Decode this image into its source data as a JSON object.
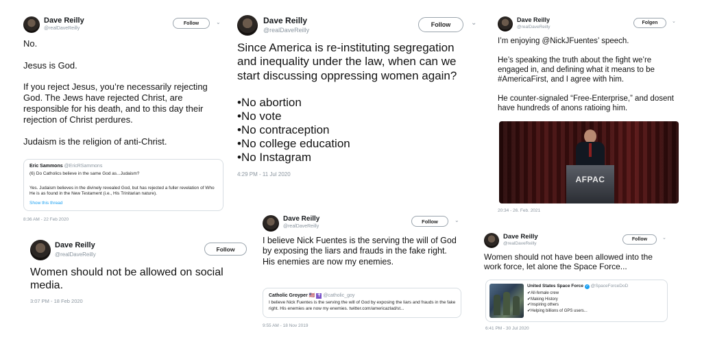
{
  "t1": {
    "name": "Dave Reilly",
    "handle": "@realDaveReilly",
    "follow": "Follow",
    "body": "No.\n\nJesus is God.\n\nIf you reject Jesus, you’re necessarily rejecting God. The Jews have rejected Christ, are responsible for his death, and to this day their rejection of Christ perdures.\n\nJudaism is the religion of anti-Christ.",
    "quote": {
      "name": "Eric Sammons",
      "handle": "@EricRSammons",
      "line1": "(6) Do Catholics believe in the same God as...Judaism?",
      "line2": "Yes. Judaism believes in the divinely revealed God, but has rejected a fuller revelation of Who He is as found in the New Testament (i.e., His Trinitarian nature).",
      "link": "Show this thread"
    },
    "time": "8:36 AM - 22 Feb 2020"
  },
  "t2": {
    "name": "Dave Reilly",
    "handle": "@realDaveReilly",
    "follow": "Follow",
    "body": "Since America is re-instituting segregation and inequality under the law, when can we start discussing oppressing women again?",
    "bullets": [
      "•No abortion",
      "•No vote",
      "•No contraception",
      "•No college education",
      "•No Instagram"
    ],
    "time": "4:29 PM - 11 Jul 2020"
  },
  "t3": {
    "name": "Dave Reilly",
    "handle": "@realDaveReilly",
    "follow": "Folgen",
    "body": "I’m enjoying @NickJFuentes’ speech.\n\nHe’s speaking the truth about the fight we’re engaged in, and defining what it means to be #AmericaFirst, and I agree with him.\n\nHe counter-signaled “Free-Enterprise,” and dosent have hundreds of anons ratioing him.",
    "image_sign": "AFPAC",
    "time": "20:34 - 26. Feb. 2021"
  },
  "t4": {
    "name": "Dave Reilly",
    "handle": "@realDaveReilly",
    "follow": "Follow",
    "body": "Women should not be allowed on social media.",
    "time": "3:07 PM - 18 Feb 2020"
  },
  "t5": {
    "name": "Dave Reilly",
    "handle": "@realDaveReilly",
    "follow": "Follow",
    "body": "I believe Nick Fuentes is the serving the will of God by exposing the liars and frauds in the fake right. His enemies are now my enemies.",
    "quote": {
      "name": "Catholic Groyper",
      "handle": "@catholic_goy",
      "text": "I believe Nick Fuentes is the serving the will of God by exposing the liars and frauds in the fake right. His enemies are now my enemies. twitter.com/americazlad/st..."
    },
    "time": "9:55 AM - 18 Nov 2019"
  },
  "t6": {
    "name": "Dave Reilly",
    "handle": "@realDaveReilly",
    "follow": "Follow",
    "body": "Women should not have been allowed into the work force, let alone the Space Force...",
    "quote": {
      "name": "United States Space Force",
      "handle": "@SpaceForceDoD",
      "items": [
        "✔All-female crew",
        "✔Making History",
        "✔Inspiring others",
        "✔Helping billions of GPS users..."
      ]
    },
    "time": "6:41 PM - 30 Jul 2020"
  },
  "colors": {
    "handle_gray": "#8a959f",
    "text": "#111111",
    "border": "#d7dde2",
    "verified": "#1da1f2"
  }
}
